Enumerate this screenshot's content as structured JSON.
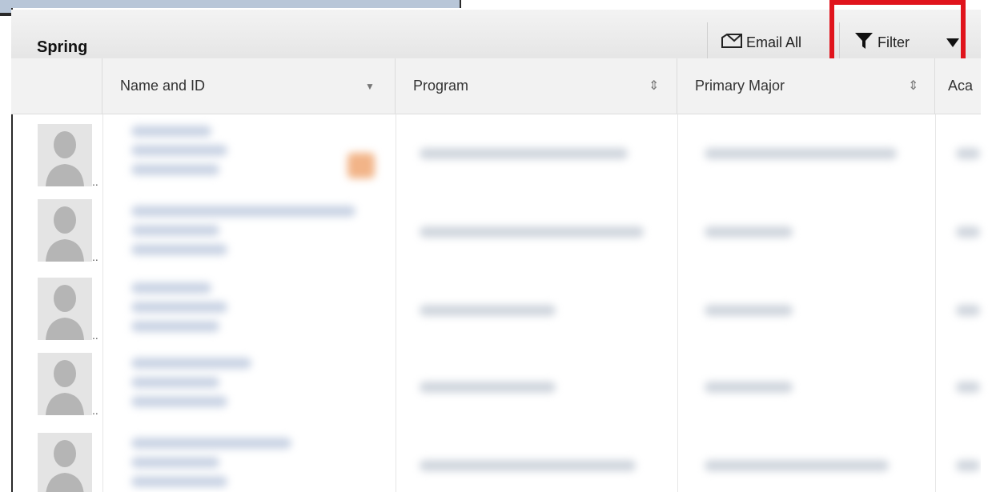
{
  "panel": {
    "title": "Spring",
    "email_all_label": "Email All",
    "filter_label": "Filter"
  },
  "columns": [
    {
      "label": "Name and ID"
    },
    {
      "label": "Program"
    },
    {
      "label": "Primary Major"
    },
    {
      "label": "Aca"
    }
  ],
  "rows": [
    {
      "avatar_ellipsis": ".."
    },
    {
      "avatar_ellipsis": ".."
    },
    {
      "avatar_ellipsis": ".."
    },
    {
      "avatar_ellipsis": ".."
    },
    {
      "avatar_ellipsis": ".."
    }
  ],
  "colors": {
    "highlight": "#e0141c",
    "header_bg": "#eeeeee",
    "avatar_bg": "#e4e4e4"
  }
}
